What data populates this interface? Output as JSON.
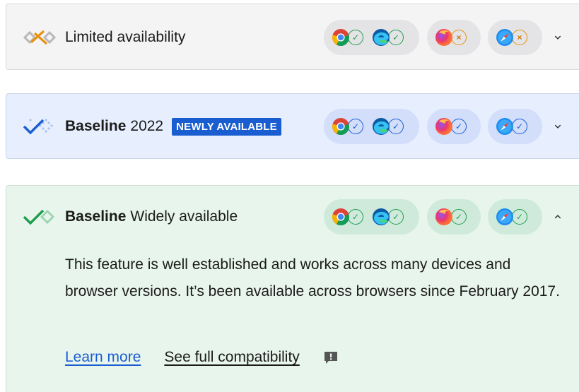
{
  "colors": {
    "green": "#1e9e4f",
    "blue": "#1a5dd1",
    "orange": "#e6920f",
    "limited_bg": "#f4f4f5",
    "newly_bg": "#e7effe",
    "wide_bg": "#e8f5ec"
  },
  "limited": {
    "label": "Limited availability",
    "icon": "limited-availability-icon",
    "browsers": {
      "chrome": "supported",
      "edge": "supported",
      "firefox": "unsupported",
      "safari": "unsupported"
    }
  },
  "newly": {
    "label_bold": "Baseline",
    "label_year": "2022",
    "badge": "NEWLY AVAILABLE",
    "icon": "baseline-newly-icon",
    "browsers": {
      "chrome": "supported",
      "edge": "supported",
      "firefox": "supported",
      "safari": "supported"
    }
  },
  "wide": {
    "label_bold": "Baseline",
    "label_rest": "Widely available",
    "icon": "baseline-widely-icon",
    "browsers": {
      "chrome": "supported",
      "edge": "supported",
      "firefox": "supported",
      "safari": "supported"
    },
    "description": "This feature is well established and works across many devices and browser versions. It’s been available across browsers since February 2017.",
    "learn_more": "Learn more",
    "see_full": "See full compatibility"
  },
  "status_glyphs": {
    "supported": "✓",
    "unsupported": "×"
  }
}
